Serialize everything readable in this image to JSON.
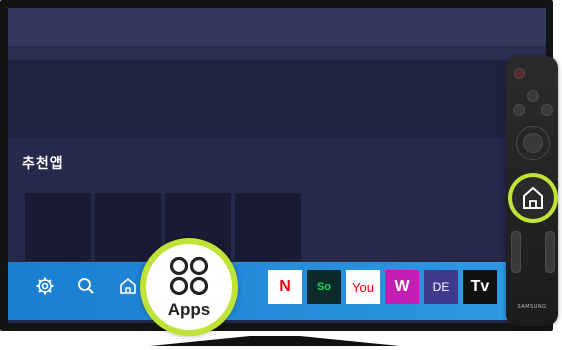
{
  "section": {
    "title": "추천앱"
  },
  "taskbar": {
    "settings_icon": "gear-icon",
    "search_icon": "search-icon",
    "home_icon": "home-icon",
    "apps_label": "Apps",
    "apps_icon": "apps-grid-icon"
  },
  "apps": [
    {
      "label": "N",
      "bg": "#ffffff",
      "fg": "#e50914"
    },
    {
      "label": "So",
      "bg": "#0d2a2a",
      "fg": "#1ed760"
    },
    {
      "label": "You",
      "bg": "#ffffff",
      "fg": "#ff0000"
    },
    {
      "label": "W",
      "bg": "#c21fb4",
      "fg": "#ffffff"
    },
    {
      "label": "DE",
      "bg": "#3f3a8c",
      "fg": "#ffffff"
    },
    {
      "label": "Tv",
      "bg": "#111111",
      "fg": "#ffffff"
    }
  ],
  "remote": {
    "brand": "SAMSUNG",
    "highlight_icon": "home-icon"
  },
  "colors": {
    "highlight": "#bfe336",
    "taskbar": "#1a7fd0"
  }
}
